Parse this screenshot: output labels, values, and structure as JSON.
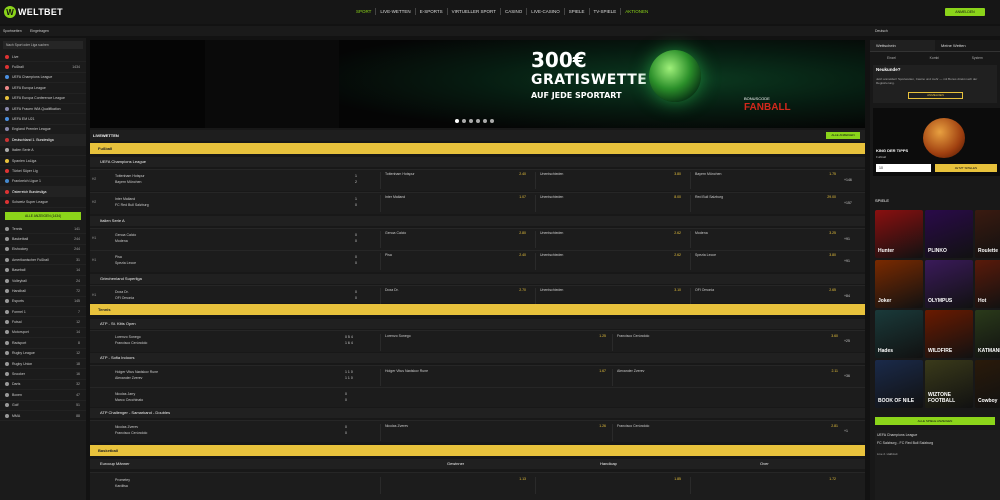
{
  "brand": {
    "name": "WELTBET"
  },
  "nav": [
    "SPORT",
    "LIVE-WETTEN",
    "E-SPORTS",
    "VIRTUELLER SPORT",
    "CASINO",
    "LIVE-CASINO",
    "SPIELE",
    "TV-SPIELE",
    "AKTIONEN"
  ],
  "login_label": "ANMELDEN",
  "subbar": {
    "left": "Sportwetten",
    "left2": "Eingetragen",
    "right": "Deutsch"
  },
  "sidebar": {
    "search": "Nach Sport oder Liga suchen",
    "items": [
      {
        "label": "Live",
        "count": ""
      },
      {
        "label": "Fußball",
        "count": "1434"
      },
      {
        "label": "UEFA Champions League",
        "count": ""
      },
      {
        "label": "UEFA Europa League",
        "count": ""
      },
      {
        "label": "UEFA Europa Conference League",
        "count": ""
      },
      {
        "label": "UEFA Frauen WM-Qualifikation",
        "count": ""
      },
      {
        "label": "UEFA EM U21",
        "count": ""
      },
      {
        "label": "England Premier League",
        "count": ""
      },
      {
        "label": "Deutschland 1. Bundesliga",
        "count": ""
      },
      {
        "label": "Italien Serie A",
        "count": ""
      },
      {
        "label": "Spanien LaLiga",
        "count": ""
      },
      {
        "label": "Türkei Süper Lig",
        "count": ""
      },
      {
        "label": "Frankreich Ligue 1",
        "count": ""
      },
      {
        "label": "Österreich Bundesliga",
        "count": ""
      },
      {
        "label": "Schweiz Super League",
        "count": ""
      }
    ],
    "all_label": "ALLE ANZEIGEN (1434)",
    "sports": [
      {
        "label": "Tennis",
        "count": "141"
      },
      {
        "label": "Basketball",
        "count": "244"
      },
      {
        "label": "Eishockey",
        "count": "244"
      },
      {
        "label": "Amerikanischer Fußball",
        "count": "31"
      },
      {
        "label": "Baseball",
        "count": "14"
      },
      {
        "label": "Volleyball",
        "count": "24"
      },
      {
        "label": "Handball",
        "count": "72"
      },
      {
        "label": "Esports",
        "count": "145"
      },
      {
        "label": "Formel 1",
        "count": "7"
      },
      {
        "label": "Futsal",
        "count": "12"
      },
      {
        "label": "Motorsport",
        "count": "14"
      },
      {
        "label": "Radsport",
        "count": "8"
      },
      {
        "label": "Rugby League",
        "count": "12"
      },
      {
        "label": "Rugby Union",
        "count": "18"
      },
      {
        "label": "Snooker",
        "count": "16"
      },
      {
        "label": "Darts",
        "count": "32"
      },
      {
        "label": "Boxen",
        "count": "47"
      },
      {
        "label": "Golf",
        "count": "51"
      },
      {
        "label": "MMA",
        "count": "88"
      }
    ]
  },
  "banner": {
    "amount": "300€",
    "line1": "GRATISWETTE",
    "line2": "AUF JEDE SPORTART",
    "code_label": "BONUSCODE",
    "code": "FANBALL"
  },
  "live": {
    "title": "LIVEWETTEN",
    "button": "ALLE ANZEIGEN"
  },
  "sections": {
    "fussball": "Fußball",
    "tennis": "Tennis",
    "basketball": "Basketball"
  },
  "leagues": {
    "ucl": "UEFA Champions League",
    "ita": "Italien Serie A",
    "grc": "Griechenland Superliga",
    "atp": "ATP - St. Kitts Open",
    "atp2": "ATP - Sofia Indoors",
    "atpc": "ATP Challenger - Samarkand - Doubles",
    "euro": "Eurocup Männer"
  },
  "matches": [
    {
      "time": "H2",
      "t1": "Tottenham Hotspur",
      "t2": "Bayern München",
      "s1": "1",
      "s2": "2",
      "o1n": "Tottenham Hotspur",
      "o1": "2.40",
      "o2n": "Unentschieden",
      "o2": "3.80",
      "o3n": "Bayern München",
      "o3": "1.75",
      "more": "+146"
    },
    {
      "time": "H2",
      "t1": "Inter Mailand",
      "t2": "FC Red Bull Salzburg",
      "s1": "1",
      "s2": "0",
      "o1n": "Inter Mailand",
      "o1": "1.07",
      "o2n": "Unentschieden",
      "o2": "8.00",
      "o3n": "Red Bull Salzburg",
      "o3": "29.00",
      "more": "+157"
    },
    {
      "time": "H1",
      "t1": "Genoa Calcio",
      "t2": "Modena",
      "s1": "0",
      "s2": "0",
      "o1n": "Genoa Calcio",
      "o1": "2.80",
      "o2n": "Unentschieden",
      "o2": "2.62",
      "o3n": "Modena",
      "o3": "3.25",
      "more": "+91"
    },
    {
      "time": "H1",
      "t1": "Pisa",
      "t2": "Spezia Lecce",
      "s1": "0",
      "s2": "0",
      "o1n": "Pisa",
      "o1": "2.40",
      "o2n": "Unentschieden",
      "o2": "2.62",
      "o3n": "Spezia Lecce",
      "o3": "3.80",
      "more": "+91"
    },
    {
      "time": "H1",
      "t1": "Doxa Dr.",
      "t2": "OFI Omonia",
      "s1": "0",
      "s2": "0",
      "o1n": "Doxa Dr.",
      "o1": "2.70",
      "o2n": "Unentschieden",
      "o2": "3.10",
      "o3n": "OFI Omonia",
      "o3": "2.65",
      "more": "+84"
    }
  ],
  "tennis": [
    {
      "t1": "Lorenzo Sonego",
      "t2": "Francisco Cerúndolo",
      "s1": "0 5 4",
      "s2": "1 6 4",
      "o1n": "Lorenzo Sonego",
      "o1": "1.25",
      "o2n": "Francisco Cerúndolo",
      "o2": "3.60",
      "more": "+25"
    },
    {
      "t1": "Holger Vitus Nødskov Rune",
      "t2": "Alexander Zverev",
      "s1": "1 1 0",
      "s2": "1 1 0",
      "o1n": "Holger Vitus Nødskov Rune",
      "o1": "1.67",
      "o2n": "Alexander Zverev",
      "o2": "2.11",
      "more": "+36"
    },
    {
      "t1": "Nicolas Jarry",
      "t2": "Marco Cecchinato",
      "s1": "0",
      "s2": "0",
      "o1n": "",
      "o1": "",
      "o2n": "",
      "o2": "",
      "more": ""
    },
    {
      "t1": "Nicolas Zverev",
      "t2": "Francisco Cerúndolo",
      "s1": "0",
      "s2": "0",
      "o1n": "Nicolas Zverev",
      "o1": "1.26",
      "o2n": "Francisco Cerúndolo",
      "o2": "2.81",
      "more": "+1"
    }
  ],
  "basket": {
    "h1": "Gewinner",
    "h2": "Handicap",
    "h3": "Over",
    "t1": "Prometey",
    "t2": "Karditsa",
    "o1": "1.13",
    "o2": "1.85",
    "o3": "1.72"
  },
  "right": {
    "tab1": "Wettschein",
    "tab2": "Meine Wetten",
    "sub": [
      "Einzel",
      "Kombi",
      "System"
    ],
    "panel_title": "Neukunde?",
    "panel_text": "Jetzt anmelden! Sportwetten, Casino und mehr — mit Bonus direkt nach der Registrierung.",
    "panel_btn": "ANMELDEN",
    "promo_title": "KING DER TIPPS",
    "promo_sub": "Fußball",
    "promo_input": "10",
    "promo_btn": "JETZT SPIELEN",
    "spiele": "SPIELE",
    "tiles": [
      "Hunter",
      "PLINKO",
      "Roulette",
      "Joker",
      "OLYMPUS",
      "Hot",
      "Hades",
      "WILDFIRE",
      "KATMANDU",
      "BOOK OF NILE",
      "WIZTONE FOOTBALL",
      "Cowboy"
    ],
    "all_games": "ALLE SPIELE ANZEIGEN",
    "wt_a": "UEFA Champions League",
    "wt_b": "FC Salzburg - FC Red Bull Salzburg",
    "wt_c": "Live 2. Halbzeit"
  }
}
